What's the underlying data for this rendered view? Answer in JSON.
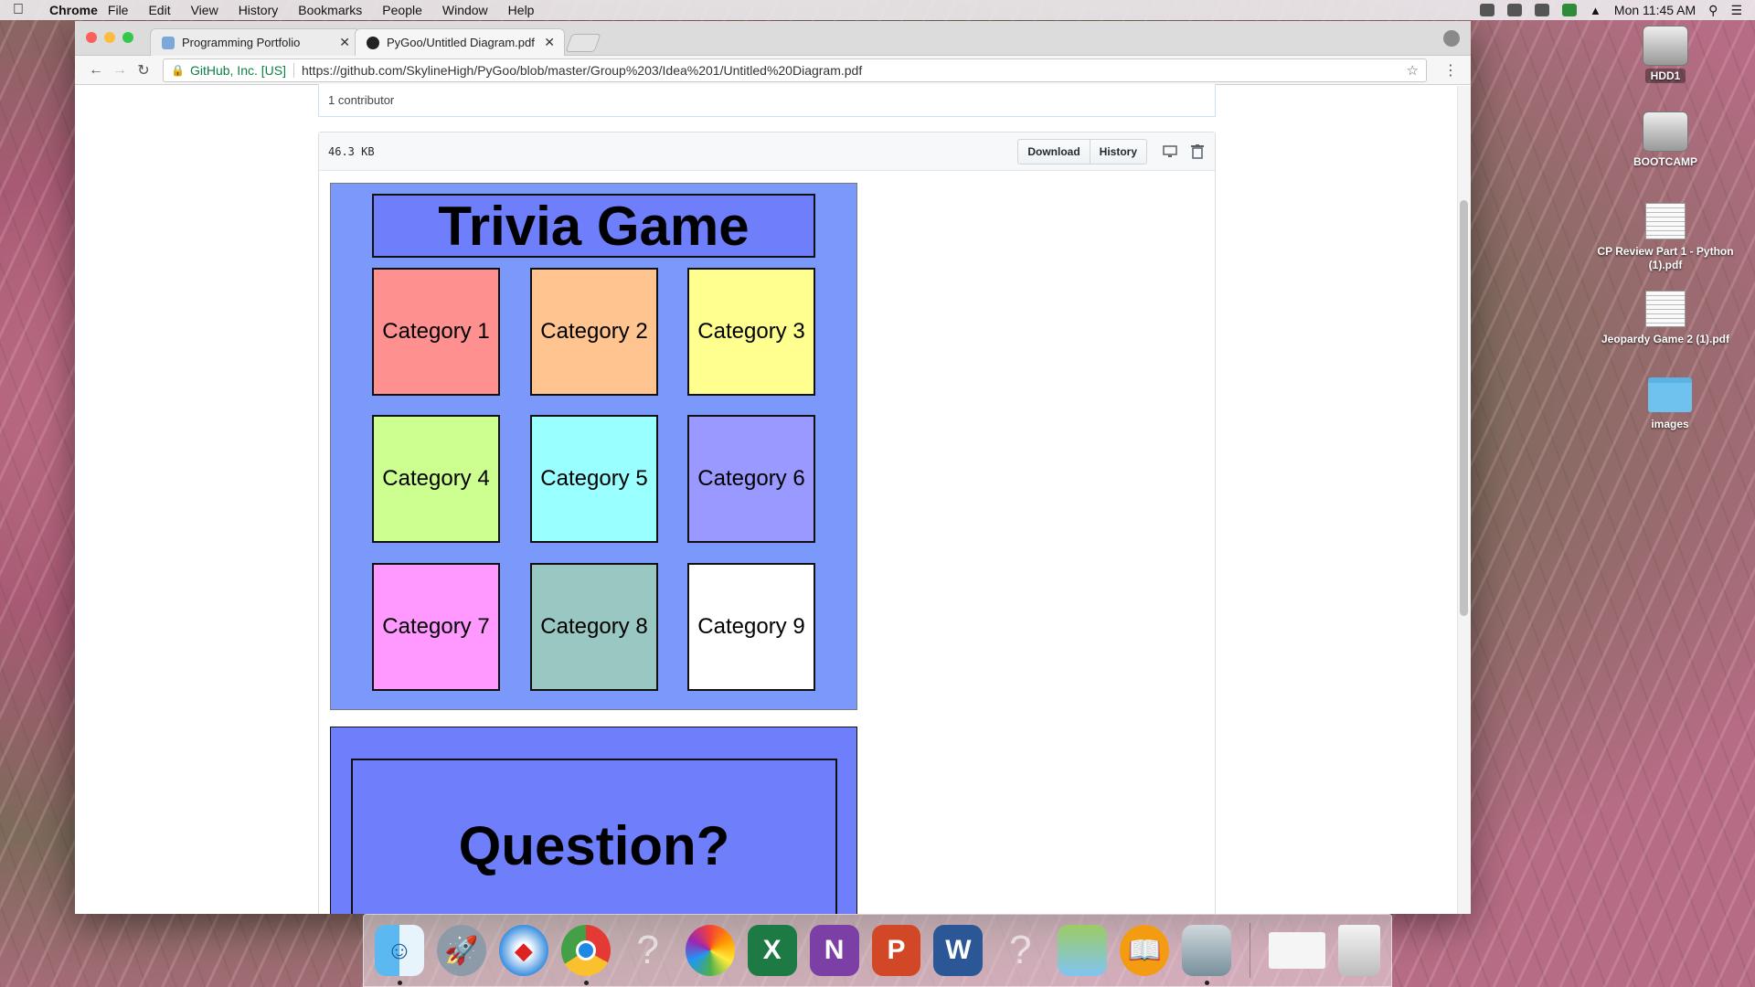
{
  "menubar": {
    "app": "Chrome",
    "items": [
      "File",
      "Edit",
      "View",
      "History",
      "Bookmarks",
      "People",
      "Window",
      "Help"
    ],
    "clock": "Mon 11:45 AM"
  },
  "browser": {
    "tabs": [
      {
        "title": "Programming Portfolio",
        "active": false
      },
      {
        "title": "PyGoo/Untitled Diagram.pdf at",
        "active": true
      }
    ],
    "secure_label": "GitHub, Inc. [US]",
    "url": "https://github.com/SkylineHigh/PyGoo/blob/master/Group%203/Idea%201/Untitled%20Diagram.pdf"
  },
  "github": {
    "contributors": "1 contributor",
    "file_size": "46.3 KB",
    "download_label": "Download",
    "history_label": "History"
  },
  "diagram": {
    "title": "Trivia Game",
    "categories": [
      {
        "label": "Category 1",
        "color": "#ff9090"
      },
      {
        "label": "Category 2",
        "color": "#ffc490"
      },
      {
        "label": "Category 3",
        "color": "#ffff90"
      },
      {
        "label": "Category 4",
        "color": "#ccff90"
      },
      {
        "label": "Category 5",
        "color": "#99ffff"
      },
      {
        "label": "Category 6",
        "color": "#9999ff"
      },
      {
        "label": "Category 7",
        "color": "#ff99ff"
      },
      {
        "label": "Category 8",
        "color": "#99c7c1"
      },
      {
        "label": "Category 9",
        "color": "#ffffff"
      }
    ],
    "question": "Question?"
  },
  "desktop": {
    "icons": [
      {
        "label": "HDD1",
        "icon": "drive-icon"
      },
      {
        "label": "BOOTCAMP",
        "icon": "drive-icon"
      },
      {
        "label": "CP Review Part 1 - Python (1).pdf",
        "icon": "pdf-icon"
      },
      {
        "label": "Jeopardy Game 2 (1).pdf",
        "icon": "pdf-icon"
      },
      {
        "label": "images",
        "icon": "folder-icon"
      }
    ]
  },
  "dock": {
    "items": [
      "finder-icon",
      "launchpad-icon",
      "safari-icon",
      "chrome-icon",
      "unknown-app-icon",
      "photos-icon",
      "excel-icon",
      "onenote-icon",
      "powerpoint-icon",
      "word-icon",
      "unknown-app-icon",
      "maps-icon",
      "ibooks-icon",
      "preview-icon",
      "downloads-stack-icon",
      "trash-icon"
    ]
  }
}
